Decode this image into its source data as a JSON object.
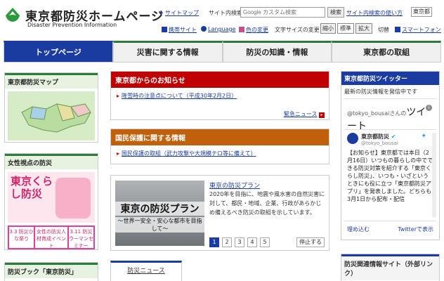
{
  "header": {
    "title": "東京都防災ホームページ",
    "subtitle": "Disaster Prevention Information",
    "sitemap": "サイトマップ",
    "search_label": "サイト内検索",
    "search_placeholder": "Google カスタム検索",
    "search_button": "検索",
    "search_help": "サイト内検索の使い方",
    "language_selector": "東京都",
    "mobile": "携帯サイト",
    "language": "Language",
    "color_change": "色の変更",
    "fontsize_label": "文字サイズの変更",
    "fontsize_small": "縮小",
    "fontsize_normal": "標準",
    "fontsize_large": "拡大",
    "switch": "切替",
    "smartphone": "スマートフォン"
  },
  "nav": {
    "items": [
      "トップページ",
      "災害に関する情報",
      "防災の知識・情報",
      "東京都の取組"
    ],
    "active_index": 0
  },
  "left": {
    "map_title": "東京都防災マップ",
    "women_title": "女性視点の防災",
    "women_banner": "東京くらし防災",
    "women_sub1": "3.3 防災ひな祭り",
    "women_sub2": "女性の防災人材育成イベント",
    "women_sub3": "3.11 防災ウーマンセミナー",
    "book_title": "防災ブック「東京防災」"
  },
  "notices": {
    "tokyo_title": "東京都からのお知らせ",
    "tokyo_link": "降雪時の注意点について（平成30年2月2日）",
    "urgent_news": "緊急ニュース",
    "civil_title": "国民保護に関する情報",
    "civil_link": "国民保護の取組（武力攻撃や大規模テロ等に備えて）"
  },
  "plan": {
    "image_title": "東京の防災プラン",
    "image_sub": "〜世界一安全・安心な都市を目指して〜",
    "heading": "東京の防災プラン",
    "text": "2020年を目指に、地震や風水害の自然災害に対して、都民・地域、企業、行政があらかじめ備えるべき防災の取組を示しています。",
    "pages": [
      "1",
      "2",
      "3",
      "4",
      "5"
    ],
    "active_page": 0,
    "stop": "停止する"
  },
  "bosai_news_tab": "防災ニュース",
  "twitter": {
    "title": "東京都防災ツイッター",
    "desc": "最新の防災情報を発信中です",
    "handle_line": "@tokyo_bousaiさんの",
    "tweet_word": "ツイート",
    "account_name": "東京都防災",
    "account_handle": "@tokyo_bousai",
    "tweet_text": "【お知らせ】東京都では本日（2月16日）いつもの暮らしの中でできる防災対策を紹介する「東京くらし防災」、いつも・いざというときにも役に立つ「東京都防災アプリ」を発表しました。どちらも3月1日から配布・配信",
    "embed": "埋め込む",
    "view_on": "Twitterで表示"
  },
  "links_title": "防災関連情報サイト（外部リンク）",
  "colors": {
    "brand_green": "#2c7a3c",
    "nav_blue": "#1a3ca0",
    "notice_red": "#c00000",
    "notice_orange": "#c0600a"
  }
}
